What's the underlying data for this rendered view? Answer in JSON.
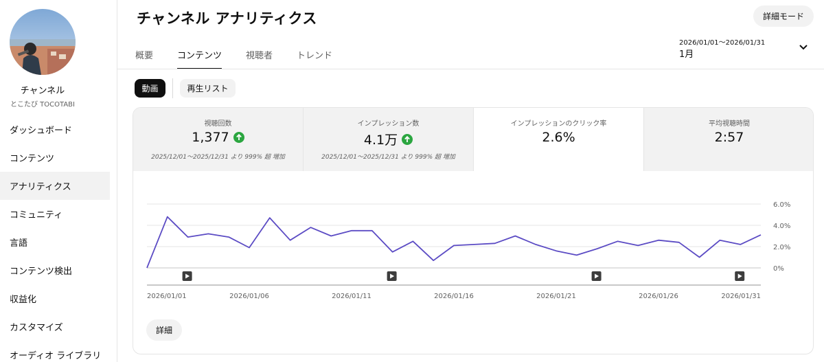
{
  "sidebar": {
    "channel_label": "チャンネル",
    "channel_name": "とこたび TOCOTABI",
    "items": [
      {
        "label": "ダッシュボード",
        "active": false
      },
      {
        "label": "コンテンツ",
        "active": false
      },
      {
        "label": "アナリティクス",
        "active": true
      },
      {
        "label": "コミュニティ",
        "active": false
      },
      {
        "label": "言語",
        "active": false
      },
      {
        "label": "コンテンツ検出",
        "active": false
      },
      {
        "label": "収益化",
        "active": false
      },
      {
        "label": "カスタマイズ",
        "active": false
      },
      {
        "label": "オーディオ ライブラリ",
        "active": false
      }
    ]
  },
  "header": {
    "title": "チャンネル アナリティクス",
    "advanced_mode_label": "詳細モード",
    "tabs": [
      {
        "label": "概要",
        "active": false
      },
      {
        "label": "コンテンツ",
        "active": true
      },
      {
        "label": "視聴者",
        "active": false
      },
      {
        "label": "トレンド",
        "active": false
      }
    ],
    "date_range": "2026/01/01～2026/01/31",
    "date_period": "1月",
    "dropdown_icon": "chevron-down-icon"
  },
  "chips": {
    "video": "動画",
    "playlist": "再生リスト"
  },
  "metrics": [
    {
      "label": "視聴回数",
      "value": "1,377",
      "trend": "up",
      "compare": "2025/12/01～2025/12/31 より 999% 超 増加",
      "selected": false
    },
    {
      "label": "インプレッション数",
      "value": "4.1万",
      "trend": "up",
      "compare": "2025/12/01～2025/12/31 より 999% 超 増加",
      "selected": false
    },
    {
      "label": "インプレッションのクリック率",
      "value": "2.6%",
      "trend": "",
      "compare": "",
      "selected": true
    },
    {
      "label": "平均視聴時間",
      "value": "2:57",
      "trend": "",
      "compare": "",
      "selected": false
    }
  ],
  "colors": {
    "line": "#5b4bc4",
    "trend_up": "#2ba640"
  },
  "details_label": "詳細",
  "chart_data": {
    "type": "line",
    "x": [
      "2026/01/01",
      "2026/01/02",
      "2026/01/03",
      "2026/01/04",
      "2026/01/05",
      "2026/01/06",
      "2026/01/07",
      "2026/01/08",
      "2026/01/09",
      "2026/01/10",
      "2026/01/11",
      "2026/01/12",
      "2026/01/13",
      "2026/01/14",
      "2026/01/15",
      "2026/01/16",
      "2026/01/17",
      "2026/01/18",
      "2026/01/19",
      "2026/01/20",
      "2026/01/21",
      "2026/01/22",
      "2026/01/23",
      "2026/01/24",
      "2026/01/25",
      "2026/01/26",
      "2026/01/27",
      "2026/01/28",
      "2026/01/29",
      "2026/01/30",
      "2026/01/31"
    ],
    "values": [
      0.0,
      4.8,
      2.9,
      3.2,
      2.9,
      1.9,
      4.7,
      2.6,
      3.8,
      3.0,
      3.5,
      3.5,
      1.5,
      2.5,
      0.7,
      2.1,
      2.2,
      2.3,
      3.0,
      2.2,
      1.6,
      1.2,
      1.8,
      2.5,
      2.1,
      2.6,
      2.4,
      1.0,
      2.6,
      2.2,
      3.1
    ],
    "x_tick_labels": [
      "2026/01/01",
      "2026/01/06",
      "2026/01/11",
      "2026/01/16",
      "2026/01/21",
      "2026/01/26",
      "2026/01/31"
    ],
    "x_tick_index": [
      0,
      5,
      10,
      15,
      20,
      25,
      30
    ],
    "y_tick_labels": [
      "6.0%",
      "4.0%",
      "2.0%",
      "0%"
    ],
    "y_tick_values": [
      6,
      4,
      2,
      0
    ],
    "ylim": [
      0,
      6
    ],
    "grid": true,
    "video_markers_index": [
      2,
      12,
      22,
      29
    ]
  }
}
